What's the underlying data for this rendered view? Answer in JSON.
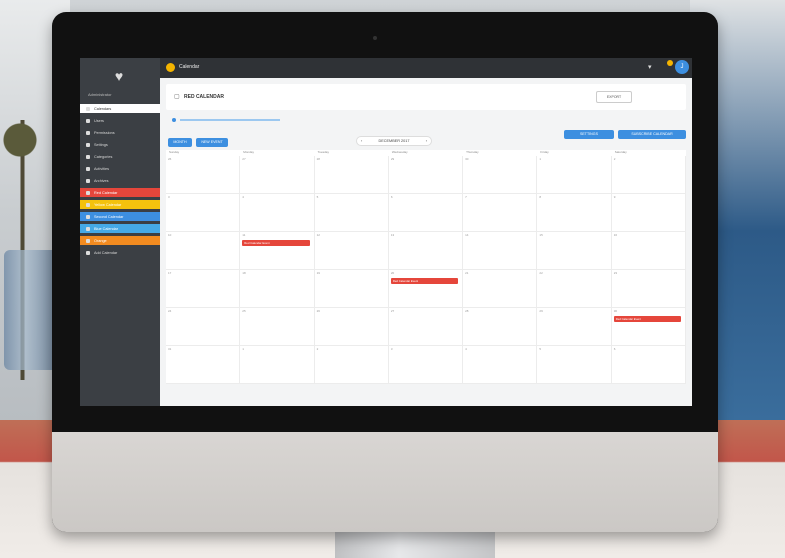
{
  "app": {
    "title": "Calendar",
    "icon": "app-logo-icon",
    "accent": "#3d8fe0",
    "topbar_bg": "#2f3236",
    "user_initial": "J"
  },
  "sidebar": {
    "logo": "app-logo",
    "user": "Administrator",
    "items": [
      {
        "label": "Calendars",
        "icon": "calendar-icon",
        "style": "active"
      },
      {
        "label": "Users",
        "icon": "user-icon",
        "style": "default"
      },
      {
        "label": "Permissions",
        "icon": "lock-icon",
        "style": "default"
      },
      {
        "label": "Settings",
        "icon": "gear-icon",
        "style": "default"
      },
      {
        "label": "Categories",
        "icon": "tag-icon",
        "style": "default"
      },
      {
        "label": "Activities",
        "icon": "list-icon",
        "style": "default"
      },
      {
        "label": "Archives",
        "icon": "archive-icon",
        "style": "default"
      },
      {
        "label": "Red Calendar",
        "icon": "calendar-icon",
        "style": "red"
      },
      {
        "label": "Yellow Calendar",
        "icon": "calendar-icon",
        "style": "yellow"
      },
      {
        "label": "Second Calendar",
        "icon": "calendar-icon",
        "style": "blue"
      },
      {
        "label": "Blue Calendar",
        "icon": "calendar-icon",
        "style": "lightblue"
      },
      {
        "label": "Orange",
        "icon": "calendar-icon",
        "style": "orange"
      },
      {
        "label": "Add Calendar",
        "icon": "plus-icon",
        "style": "default"
      }
    ]
  },
  "page": {
    "title": "RED CALENDAR",
    "export_label": "EXPORT"
  },
  "toolbar": {
    "view_button": "MONTH",
    "today_button": "NEW EVENT",
    "month_label": "DECEMBER 2017",
    "right_button_1": "SETTINGS",
    "right_button_2": "SUBSCRIBE CALENDAR"
  },
  "calendar": {
    "weekdays": [
      "Sunday",
      "Monday",
      "Tuesday",
      "Wednesday",
      "Thursday",
      "Friday",
      "Saturday"
    ],
    "days": [
      "26",
      "27",
      "28",
      "29",
      "30",
      "1",
      "2",
      "3",
      "4",
      "5",
      "6",
      "7",
      "8",
      "9",
      "10",
      "11",
      "12",
      "13",
      "14",
      "15",
      "16",
      "17",
      "18",
      "19",
      "20",
      "21",
      "22",
      "23",
      "24",
      "25",
      "26",
      "27",
      "28",
      "29",
      "30",
      "31",
      "1",
      "2",
      "3",
      "4",
      "5",
      "6"
    ],
    "events": [
      {
        "cell": 15,
        "label": "Red Calendar Event"
      },
      {
        "cell": 24,
        "label": "Red Calendar Event"
      },
      {
        "cell": 34,
        "label": "Red Calendar Event"
      }
    ],
    "event_color": "#e5463b"
  }
}
